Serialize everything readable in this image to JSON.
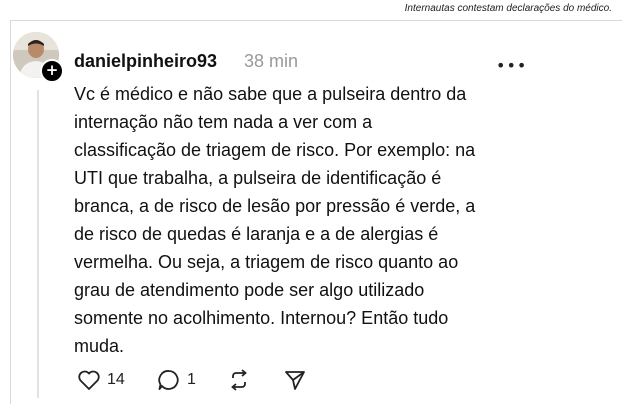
{
  "caption": "Internautas contestam declarações do médico.",
  "post": {
    "username": "danielpinheiro93",
    "time": "38 min",
    "follow_symbol": "+",
    "more_symbol": "•••",
    "lines": [
      "Vc é médico e não sabe que a pulseira dentro da",
      "internação não tem nada a ver com a",
      "classificação de triagem de risco. Por exemplo: na",
      "UTI que trabalha, a pulseira de identificação é",
      "branca, a de risco de lesão por pressão é verde, a",
      "de risco de quedas é laranja e a de alergias é",
      "vermelha. Ou seja, a triagem de risco quanto ao",
      "grau de atendimento pode ser algo utilizado",
      "somente no acolhimento. Internou? Então tudo",
      "muda."
    ]
  },
  "actions": {
    "like_count": "14",
    "reply_count": "1",
    "icons": [
      "heart-icon",
      "comment-icon",
      "repost-icon",
      "share-icon"
    ]
  }
}
